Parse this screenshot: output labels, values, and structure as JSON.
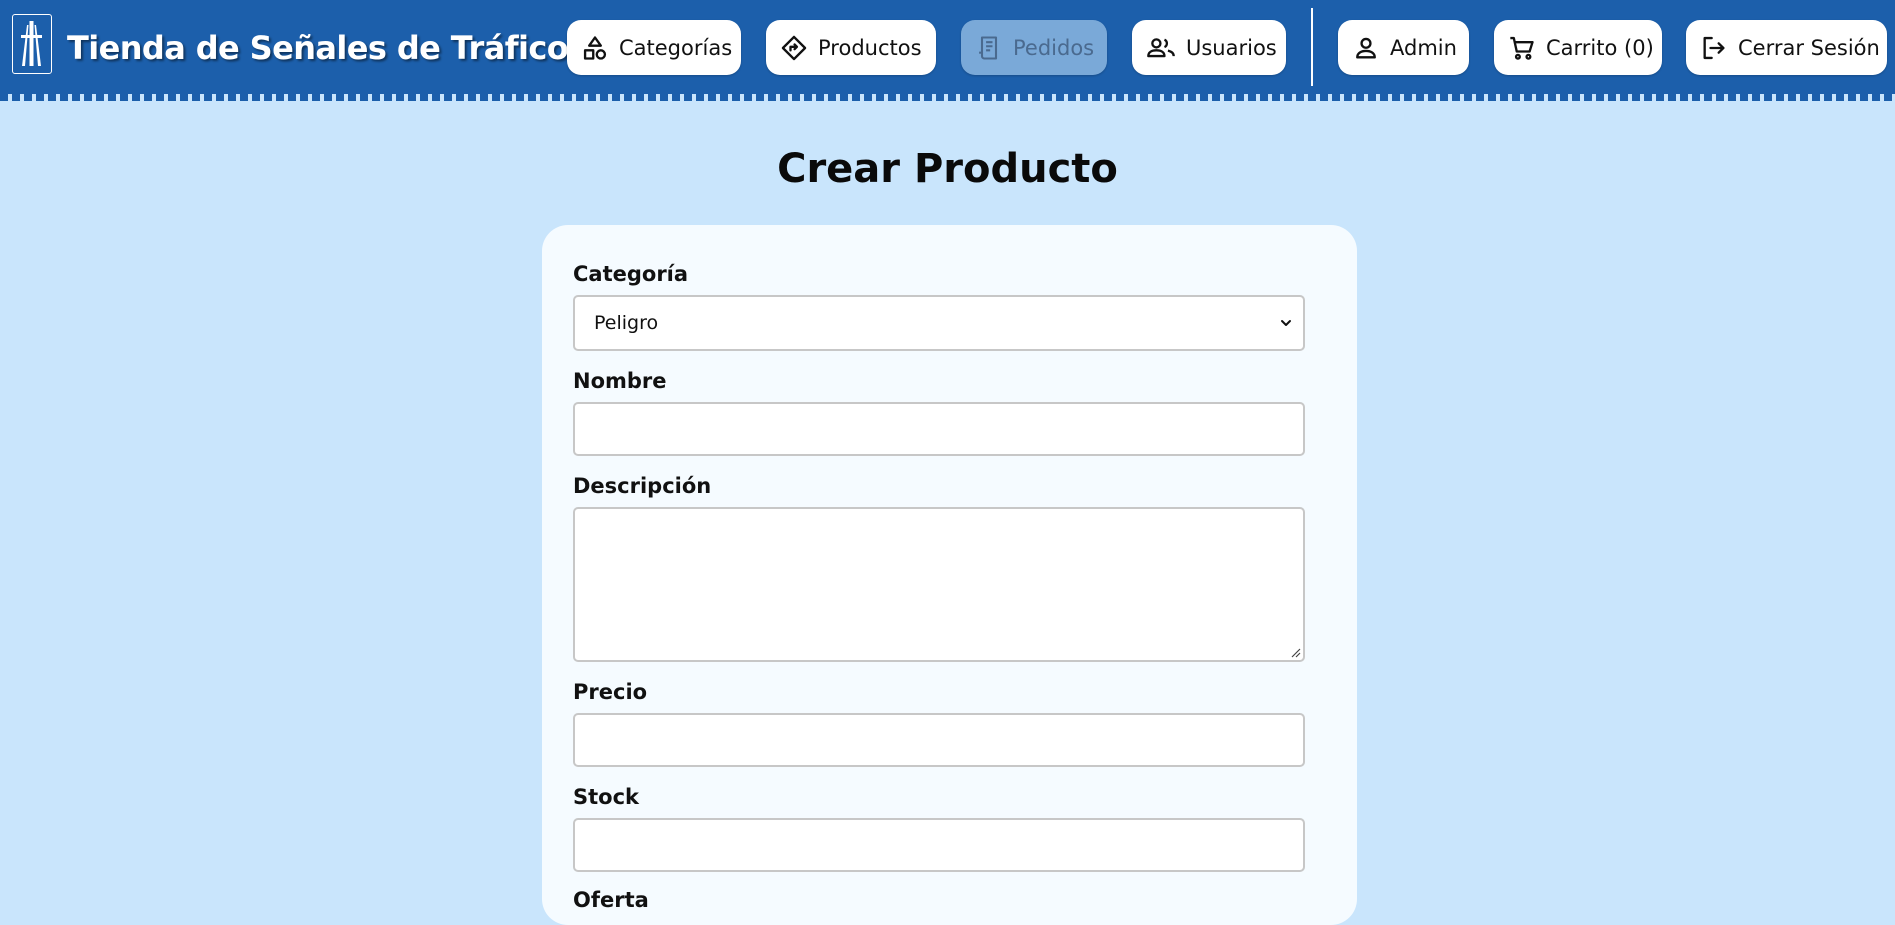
{
  "app": {
    "title": "Tienda de Señales de Tráfico",
    "logo_icon": "motorway-sign-icon"
  },
  "nav": {
    "categorias": {
      "label": "Categorías",
      "icon": "shapes-icon",
      "enabled": true
    },
    "productos": {
      "label": "Productos",
      "icon": "diamond-sign-icon",
      "enabled": true
    },
    "pedidos": {
      "label": "Pedidos",
      "icon": "receipt-icon",
      "enabled": false
    },
    "usuarios": {
      "label": "Usuarios",
      "icon": "people-icon",
      "enabled": true
    },
    "admin": {
      "label": "Admin",
      "icon": "person-icon",
      "enabled": true
    },
    "carrito": {
      "label": "Carrito (0)",
      "icon": "cart-icon",
      "enabled": true
    },
    "logout": {
      "label": "Cerrar Sesión",
      "icon": "logout-icon",
      "enabled": true
    }
  },
  "page": {
    "title": "Crear Producto"
  },
  "form": {
    "categoria": {
      "label": "Categoría",
      "value": "Peligro"
    },
    "nombre": {
      "label": "Nombre",
      "value": ""
    },
    "descripcion": {
      "label": "Descripción",
      "value": ""
    },
    "precio": {
      "label": "Precio",
      "value": ""
    },
    "stock": {
      "label": "Stock",
      "value": ""
    },
    "oferta": {
      "label": "Oferta"
    }
  },
  "colors": {
    "navbar": "#1c5fab",
    "page_background": "#c9e5fc",
    "card_background": "#f5fbff",
    "disabled_button": "#7aa9d8"
  }
}
